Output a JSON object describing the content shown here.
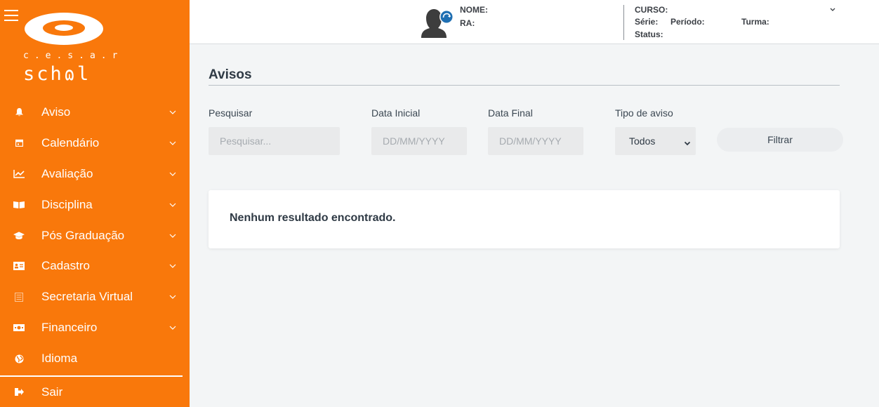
{
  "brand": {
    "line1": "c.e.s.a.r",
    "line2": "schɷl",
    "accent_color": "#f9780b"
  },
  "sidebar": {
    "items": [
      {
        "label": "Aviso",
        "icon": "bell-icon"
      },
      {
        "label": "Calendário",
        "icon": "calendar-icon"
      },
      {
        "label": "Avaliação",
        "icon": "chart-line-icon"
      },
      {
        "label": "Disciplina",
        "icon": "book-open-icon"
      },
      {
        "label": "Pós Graduação",
        "icon": "graduation-cap-icon"
      },
      {
        "label": "Cadastro",
        "icon": "id-card-icon"
      },
      {
        "label": "Secretaria Virtual",
        "icon": "document-icon"
      },
      {
        "label": "Financeiro",
        "icon": "money-icon"
      },
      {
        "label": "Idioma",
        "icon": "globe-icon"
      }
    ],
    "logout": {
      "label": "Sair",
      "icon": "sign-out-icon"
    }
  },
  "header": {
    "nome_label": "NOME:",
    "ra_label": "RA:",
    "curso_label": "CURSO:",
    "serie_label": "Série:",
    "periodo_label": "Período:",
    "turma_label": "Turma:",
    "status_label": "Status:"
  },
  "main": {
    "title": "Avisos",
    "search": {
      "label": "Pesquisar",
      "placeholder": "Pesquisar..."
    },
    "start_date": {
      "label": "Data Inicial",
      "placeholder": "DD/MM/YYYY"
    },
    "end_date": {
      "label": "Data Final",
      "placeholder": "DD/MM/YYYY"
    },
    "type": {
      "label": "Tipo de aviso",
      "value": "Todos"
    },
    "filter_button": "Filtrar",
    "empty_message": "Nenhum resultado encontrado."
  }
}
